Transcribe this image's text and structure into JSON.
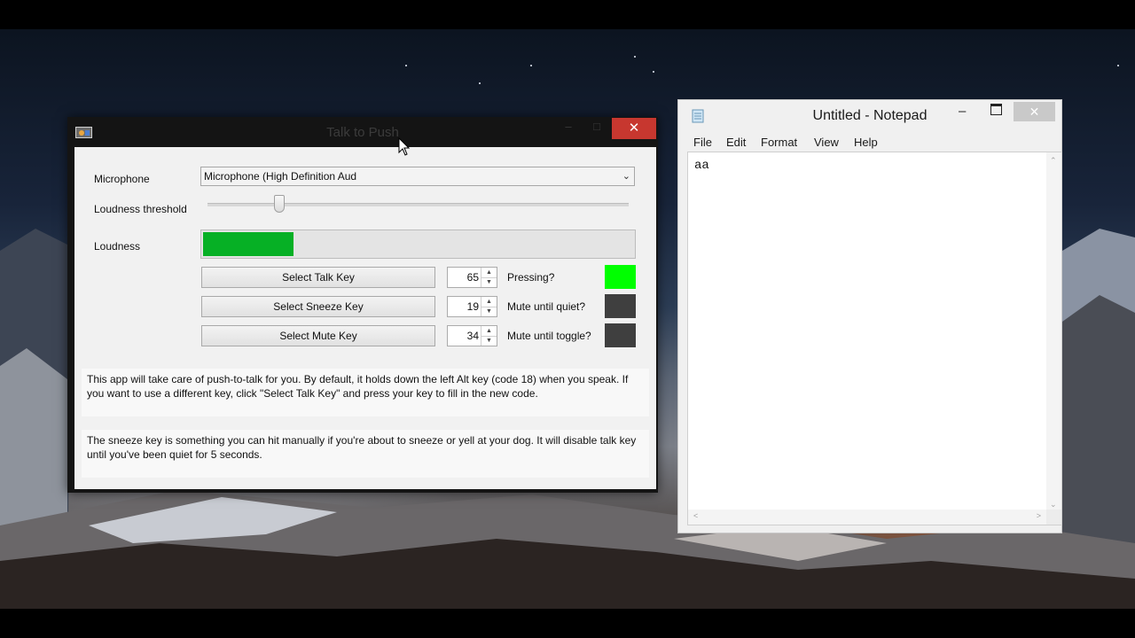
{
  "talk_to_push": {
    "title": "Talk to Push",
    "close_label": "✕",
    "minimize_label": "–",
    "maximize_label": "□",
    "microphone_label": "Microphone",
    "microphone_value": "Microphone (High Definition Aud",
    "loudness_threshold_label": "Loudness threshold",
    "loudness_threshold_level": 0.17,
    "loudness_label": "Loudness",
    "loudness_level": 0.21,
    "keys": [
      {
        "button": "Select Talk Key",
        "code": "65",
        "status_label": "Pressing?",
        "indicator_color": "#00ff00"
      },
      {
        "button": "Select Sneeze Key",
        "code": "19",
        "status_label": "Mute until quiet?",
        "indicator_color": "#3f3f3f"
      },
      {
        "button": "Select Mute Key",
        "code": "34",
        "status_label": "Mute until toggle?",
        "indicator_color": "#3f3f3f"
      }
    ],
    "info_1": "This app will take care of push-to-talk for you. By default, it holds down the left Alt key (code 18) when you speak. If you want to use a different key, click \"Select Talk Key\" and press your key to fill in the new code.",
    "info_2": "The sneeze key is something you can hit manually if you're about to sneeze or yell at your dog. It will disable talk key until you've been quiet for 5 seconds.",
    "accent_close": "#c7372f",
    "progress_color": "#06b025"
  },
  "notepad": {
    "title": "Untitled - Notepad",
    "close_label": "✕",
    "minimize_label": "–",
    "menu": [
      "File",
      "Edit",
      "Format",
      "View",
      "Help"
    ],
    "content": "aa"
  }
}
